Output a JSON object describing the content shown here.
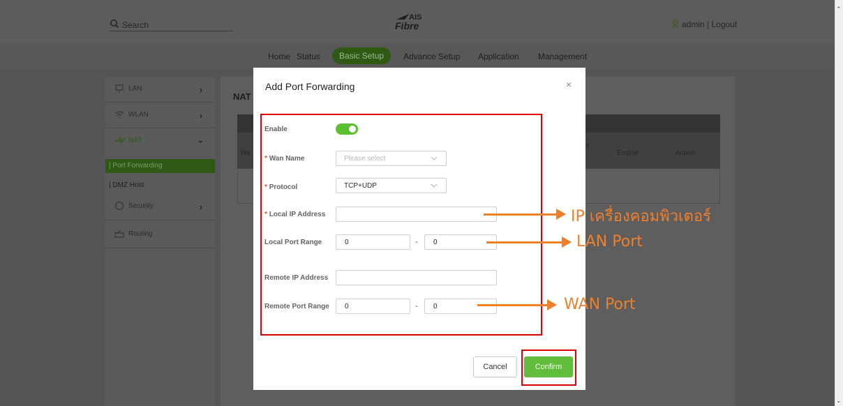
{
  "header": {
    "search_placeholder": "Search",
    "logo_ais": "AIS",
    "logo_fibre": "Fibre",
    "user_text": "admin | Logout"
  },
  "nav": {
    "items": [
      "Home",
      "Status",
      "Basic Setup",
      "Advance Setup",
      "Application",
      "Management"
    ],
    "active": "Basic Setup"
  },
  "sidebar": {
    "lan": "LAN",
    "wlan": "WLAN",
    "nat": "NAT",
    "port_forwarding": "| Port Forwarding",
    "dmz_host": "| DMZ Host",
    "security": "Security",
    "routing": "Routing"
  },
  "main": {
    "title": "NAT",
    "columns": [
      "Wa",
      "gP",
      "Enable",
      "Action"
    ]
  },
  "modal": {
    "title": "Add Port Forwarding",
    "close": "×",
    "enable_label": "Enable",
    "enable_on": true,
    "wan_name_label": "Wan Name",
    "wan_name_placeholder": "Please select",
    "protocol_label": "Protocol",
    "protocol_value": "TCP+UDP",
    "local_ip_label": "Local IP Address",
    "local_ip_value": "",
    "local_port_label": "Local Port Range",
    "local_port_from": "0",
    "local_port_to": "0",
    "remote_ip_label": "Remote IP Address",
    "remote_ip_value": "",
    "remote_port_label": "Remote Port Range",
    "remote_port_from": "0",
    "remote_port_to": "0",
    "range_sep": "-",
    "required_mark": "*",
    "cancel": "Cancel",
    "confirm": "Confirm"
  },
  "annotations": {
    "ip": "IP เครื่องคอมพิวเตอร์",
    "lan": "LAN Port",
    "wan": "WAN Port"
  },
  "colors": {
    "accent_green": "#62bd3c",
    "annotation_orange": "#f07f2a",
    "highlight_red": "#e00000"
  }
}
